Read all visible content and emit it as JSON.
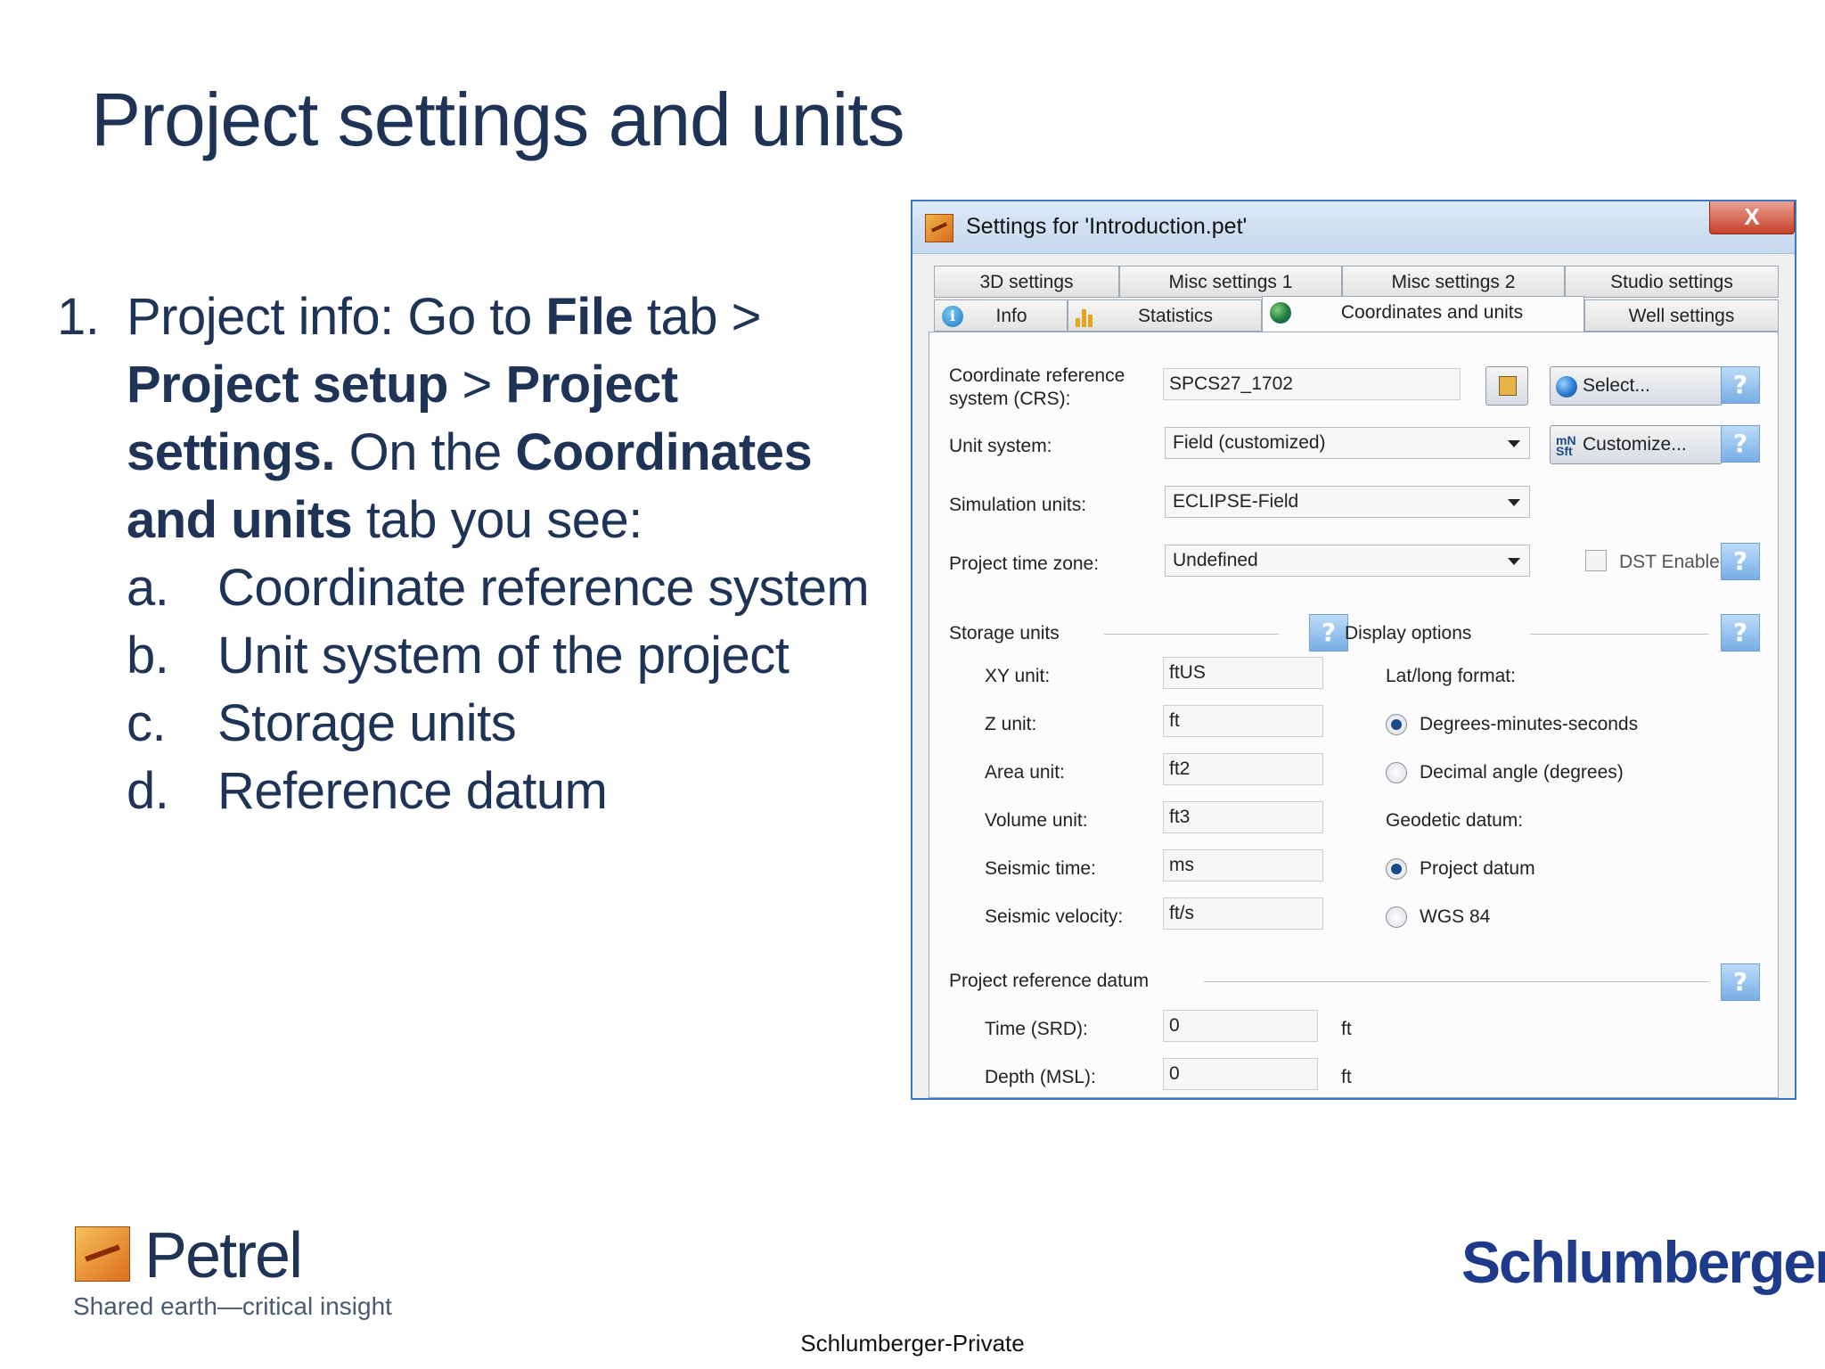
{
  "slide": {
    "title": "Project settings and units",
    "bullet": {
      "num": "1.",
      "p1": "Project info: Go to ",
      "b1": "File",
      "p2": " tab > ",
      "b2": "Project setup",
      "p3": " > ",
      "b3": "Project settings.",
      "p4": " On the ",
      "b4": "Coordinates and units",
      "p5": " tab you see:"
    },
    "sub_items": [
      {
        "letter": "a.",
        "text": "Coordinate reference system"
      },
      {
        "letter": "b.",
        "text": "Unit system of the project"
      },
      {
        "letter": "c.",
        "text": "Storage units"
      },
      {
        "letter": "d.",
        "text": "Reference datum"
      }
    ]
  },
  "dialog": {
    "title": "Settings for 'Introduction.pet'",
    "close_glyph": "X",
    "tabs_row1": [
      "3D settings",
      "Misc settings 1",
      "Misc settings 2",
      "Studio settings"
    ],
    "tabs_row2": [
      "Info",
      "Statistics",
      "Coordinates and units",
      "Well settings"
    ],
    "crs_label": "Coordinate reference system (CRS):",
    "crs_value": "SPCS27_1702",
    "select_button": "Select...",
    "unit_system_label": "Unit system:",
    "unit_system_value": "Field (customized)",
    "customize_button": "Customize...",
    "customize_icon_text": "mN Sft",
    "simulation_units_label": "Simulation units:",
    "simulation_units_value": "ECLIPSE-Field",
    "time_zone_label": "Project time zone:",
    "time_zone_value": "Undefined",
    "dst_label": "DST Enabled",
    "dst_checked": false,
    "help_glyph": "?",
    "storage_units": {
      "heading": "Storage units",
      "rows": [
        {
          "label": "XY unit:",
          "value": "ftUS"
        },
        {
          "label": "Z unit:",
          "value": "ft"
        },
        {
          "label": "Area unit:",
          "value": "ft2"
        },
        {
          "label": "Volume unit:",
          "value": "ft3"
        },
        {
          "label": "Seismic time:",
          "value": "ms"
        },
        {
          "label": "Seismic velocity:",
          "value": "ft/s"
        }
      ]
    },
    "display_options": {
      "heading": "Display options",
      "latlong_label": "Lat/long format:",
      "latlong_options": [
        "Degrees-minutes-seconds",
        "Decimal angle (degrees)"
      ],
      "latlong_selected": 0,
      "geodetic_label": "Geodetic datum:",
      "geodetic_options": [
        "Project datum",
        "WGS 84"
      ],
      "geodetic_selected": 0
    },
    "reference_datum": {
      "heading": "Project reference datum",
      "rows": [
        {
          "label": "Time (SRD):",
          "value": "0",
          "unit": "ft"
        },
        {
          "label": "Depth (MSL):",
          "value": "0",
          "unit": "ft"
        }
      ]
    }
  },
  "footer": {
    "petrel_name": "Petrel",
    "petrel_tagline": "Shared earth—critical insight",
    "company": "Schlumberger",
    "classification": "Schlumberger-Private"
  }
}
